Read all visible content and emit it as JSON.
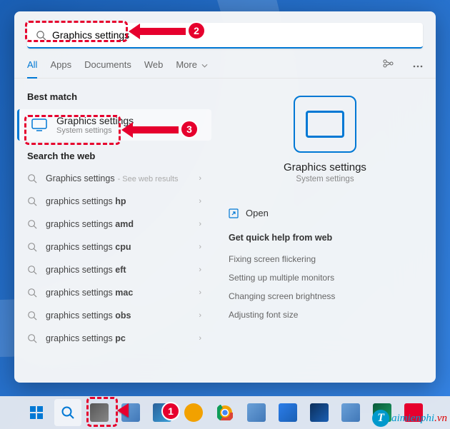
{
  "search": {
    "value": "Graphics settings"
  },
  "tabs": {
    "all": "All",
    "apps": "Apps",
    "documents": "Documents",
    "web": "Web",
    "more": "More"
  },
  "sections": {
    "best_match": "Best match",
    "search_web": "Search the web"
  },
  "best": {
    "title": "Graphics settings",
    "subtitle": "System settings"
  },
  "web": [
    {
      "label": "Graphics settings",
      "hint": "- See web results"
    },
    {
      "label": "graphics settings ",
      "bold": "hp"
    },
    {
      "label": "graphics settings ",
      "bold": "amd"
    },
    {
      "label": "graphics settings ",
      "bold": "cpu"
    },
    {
      "label": "graphics settings ",
      "bold": "eft"
    },
    {
      "label": "graphics settings ",
      "bold": "mac"
    },
    {
      "label": "graphics settings ",
      "bold": "obs"
    },
    {
      "label": "graphics settings ",
      "bold": "pc"
    }
  ],
  "preview": {
    "title": "Graphics settings",
    "subtitle": "System settings",
    "open": "Open",
    "help_header": "Get quick help from web",
    "help": [
      "Fixing screen flickering",
      "Setting up multiple monitors",
      "Changing screen brightness",
      "Adjusting font size"
    ]
  },
  "callouts": {
    "1": "1",
    "2": "2",
    "3": "3"
  },
  "watermark": {
    "letter": "T",
    "text": "aimienphi",
    "suffix": ".vn"
  }
}
